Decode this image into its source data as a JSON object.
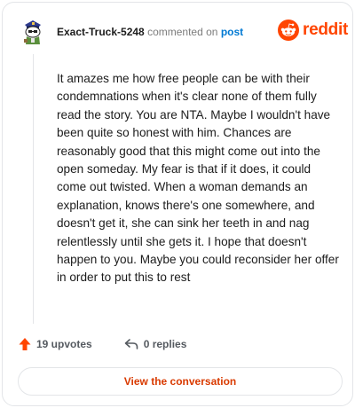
{
  "header": {
    "username": "Exact-Truck-5248",
    "commented_text": "commented on",
    "post_link": "post"
  },
  "brand": {
    "name": "reddit",
    "color": "#ff4500",
    "icon": "reddit-snoo-icon"
  },
  "comment": {
    "body": "It amazes me how free people can be with their condemnations when it's clear none of them fully read the story. You are NTA. Maybe I wouldn't have been quite so honest with him. Chances are reasonably good that this might come out into the open someday. My fear is that if it does, it could come out twisted. When a woman demands an explanation, knows there's one somewhere, and doesn't get it, she can sink her teeth in and nag relentlessly until she gets it. I hope that doesn't happen to you. Maybe you could reconsider her offer in order to put this to rest"
  },
  "actions": {
    "upvotes": "19 upvotes",
    "upvote_icon": "upvote-arrow-icon",
    "upvote_color": "#ff4500",
    "replies": "0 replies",
    "reply_icon": "reply-arrow-icon"
  },
  "cta": {
    "label": "View the conversation",
    "color": "#d93a00"
  }
}
